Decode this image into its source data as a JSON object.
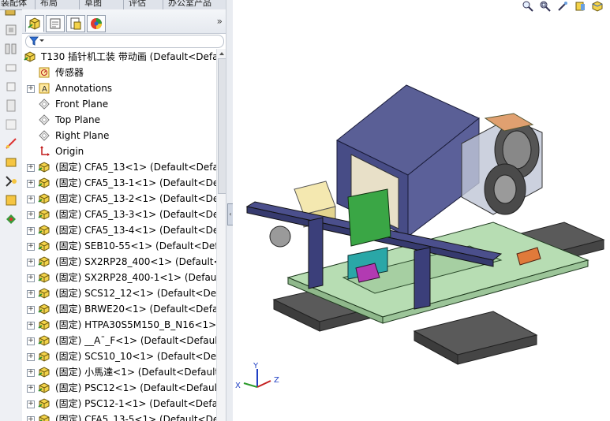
{
  "top_tabs": [
    "装配体",
    "布局",
    "草图",
    "评估",
    "办公室产品"
  ],
  "panel": {
    "expand_label": "»"
  },
  "tree": {
    "root": "T130 插针机工装 带动画  (Default<Defa",
    "items": [
      "传感器",
      "Annotations",
      "Front Plane",
      "Top Plane",
      "Right Plane",
      "Origin",
      "(固定) CFA5_13<1> (Default<Defau",
      "(固定) CFA5_13-1<1> (Default<Def",
      "(固定) CFA5_13-2<1> (Default<Def",
      "(固定) CFA5_13-3<1> (Default<Def",
      "(固定) CFA5_13-4<1> (Default<Def",
      "(固定) SEB10-55<1> (Default<Defa",
      "(固定) SX2RP28_400<1> (Default<D",
      "(固定) SX2RP28_400-1<1> (Default",
      "(固定) SCS12_12<1> (Default<Defa",
      "(固定) BRWE20<1> (Default<Defau",
      "(固定) HTPA30S5M150_B_N16<1> (",
      "(固定) __A¯_F<1> (Default<Default",
      "(固定) SCS10_10<1> (Default<Defa",
      "(固定) 小馬達<1> (Default<Default_",
      "(固定) PSC12<1> (Default<Default_",
      "(固定) PSC12-1<1> (Default<Defau",
      "(固定) CFA5_13-5<1> (Default<Def"
    ]
  },
  "triad": {
    "x": "X",
    "y": "Y",
    "z": "Z"
  },
  "colors": {
    "plate": "#b7ddb3",
    "base": "#4d4d4d",
    "housing": "#5a5f96",
    "rail": "#4b4f8c",
    "bracket": "#3b3f7a",
    "belt": "#3c3c3c",
    "accent_yellow": "#f4e8b0",
    "accent_orange": "#e0a070"
  }
}
